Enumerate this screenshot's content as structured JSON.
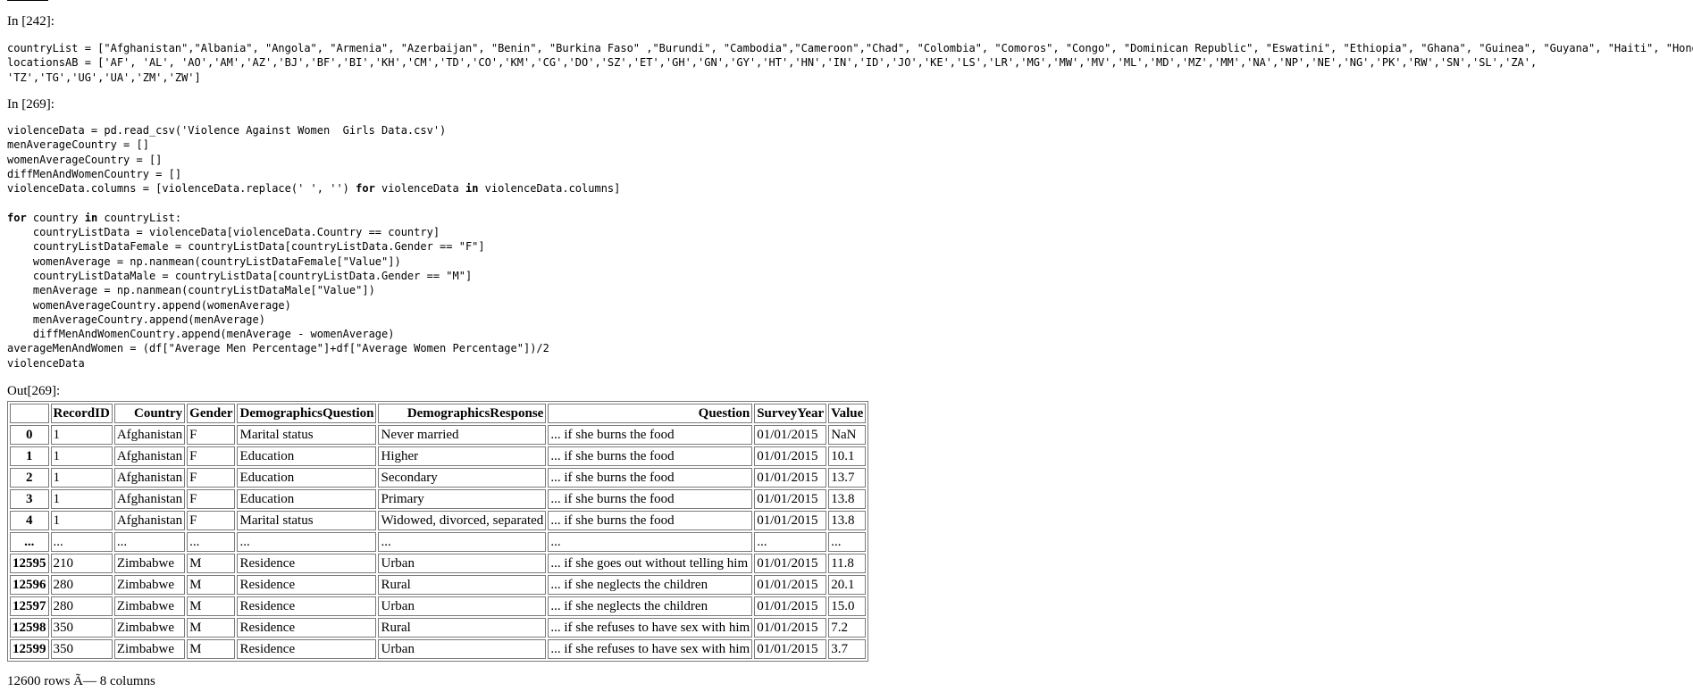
{
  "cells": {
    "c242": {
      "prompt": "In [242]:",
      "code": "countryList = [\"Afghanistan\",\"Albania\", \"Angola\", \"Armenia\", \"Azerbaijan\", \"Benin\", \"Burkina Faso\" ,\"Burundi\", \"Cambodia\",\"Cameroon\",\"Chad\", \"Colombia\", \"Comoros\", \"Congo\", \"Dominican Republic\", \"Eswatini\", \"Ethiopia\", \"Ghana\", \"Guinea\", \"Guyana\", \"Haiti\", \"Honduras\"\nlocationsAB = ['AF', 'AL', 'AO','AM','AZ','BJ','BF','BI','KH','CM','TD','CO','KM','CG','DO','SZ','ET','GH','GN','GY','HT','HN','IN','ID','JO','KE','LS','LR','MG','MW','MV','ML','MD','MZ','MM','NA','NP','NE','NG','PK','RW','SN','SL','ZA',\n'TZ','TG','UG','UA','ZM','ZW']"
    },
    "c269": {
      "prompt": "In [269]:",
      "code_part1": "violenceData = pd.read_csv('Violence Against Women  Girls Data.csv')\nmenAverageCountry = []\nwomenAverageCountry = []\ndiffMenAndWomenCountry = []\nviolenceData.columns = [violenceData.replace(' ', '') ",
      "kw_for1": "for",
      "code_part2": " violenceData ",
      "kw_in1": "in",
      "code_part3": " violenceData.columns]\n\n",
      "kw_for2": "for",
      "code_part4": " country ",
      "kw_in2": "in",
      "code_part5": " countryList:\n    countryListData = violenceData[violenceData.Country == country]\n    countryListDataFemale = countryListData[countryListData.Gender == \"F\"]\n    womenAverage = np.nanmean(countryListDataFemale[\"Value\"])\n    countryListDataMale = countryListData[countryListData.Gender == \"M\"]\n    menAverage = np.nanmean(countryListDataMale[\"Value\"])\n    womenAverageCountry.append(womenAverage)\n    menAverageCountry.append(menAverage)\n    diffMenAndWomenCountry.append(menAverage - womenAverage)\naverageMenAndWomen = (df[\"Average Men Percentage\"]+df[\"Average Women Percentage\"])/2\nviolenceData",
      "out_prompt": "Out[269]:"
    }
  },
  "table": {
    "columns": [
      "",
      "RecordID",
      "Country",
      "Gender",
      "DemographicsQuestion",
      "DemographicsResponse",
      "Question",
      "SurveyYear",
      "Value"
    ],
    "rows": [
      [
        "0",
        "1",
        "Afghanistan",
        "F",
        "Marital status",
        "Never married",
        "... if she burns the food",
        "01/01/2015",
        "NaN"
      ],
      [
        "1",
        "1",
        "Afghanistan",
        "F",
        "Education",
        "Higher",
        "... if she burns the food",
        "01/01/2015",
        "10.1"
      ],
      [
        "2",
        "1",
        "Afghanistan",
        "F",
        "Education",
        "Secondary",
        "... if she burns the food",
        "01/01/2015",
        "13.7"
      ],
      [
        "3",
        "1",
        "Afghanistan",
        "F",
        "Education",
        "Primary",
        "... if she burns the food",
        "01/01/2015",
        "13.8"
      ],
      [
        "4",
        "1",
        "Afghanistan",
        "F",
        "Marital status",
        "Widowed, divorced, separated",
        "... if she burns the food",
        "01/01/2015",
        "13.8"
      ],
      [
        "...",
        "...",
        "...",
        "...",
        "...",
        "...",
        "...",
        "...",
        "..."
      ],
      [
        "12595",
        "210",
        "Zimbabwe",
        "M",
        "Residence",
        "Urban",
        "... if she goes out without telling him",
        "01/01/2015",
        "11.8"
      ],
      [
        "12596",
        "280",
        "Zimbabwe",
        "M",
        "Residence",
        "Rural",
        "... if she neglects the children",
        "01/01/2015",
        "20.1"
      ],
      [
        "12597",
        "280",
        "Zimbabwe",
        "M",
        "Residence",
        "Urban",
        "... if she neglects the children",
        "01/01/2015",
        "15.0"
      ],
      [
        "12598",
        "350",
        "Zimbabwe",
        "M",
        "Residence",
        "Rural",
        "... if she refuses to have sex with him",
        "01/01/2015",
        "7.2"
      ],
      [
        "12599",
        "350",
        "Zimbabwe",
        "M",
        "Residence",
        "Urban",
        "... if she refuses to have sex with him",
        "01/01/2015",
        "3.7"
      ]
    ],
    "footer": "12600 rows Ã— 8 columns"
  }
}
